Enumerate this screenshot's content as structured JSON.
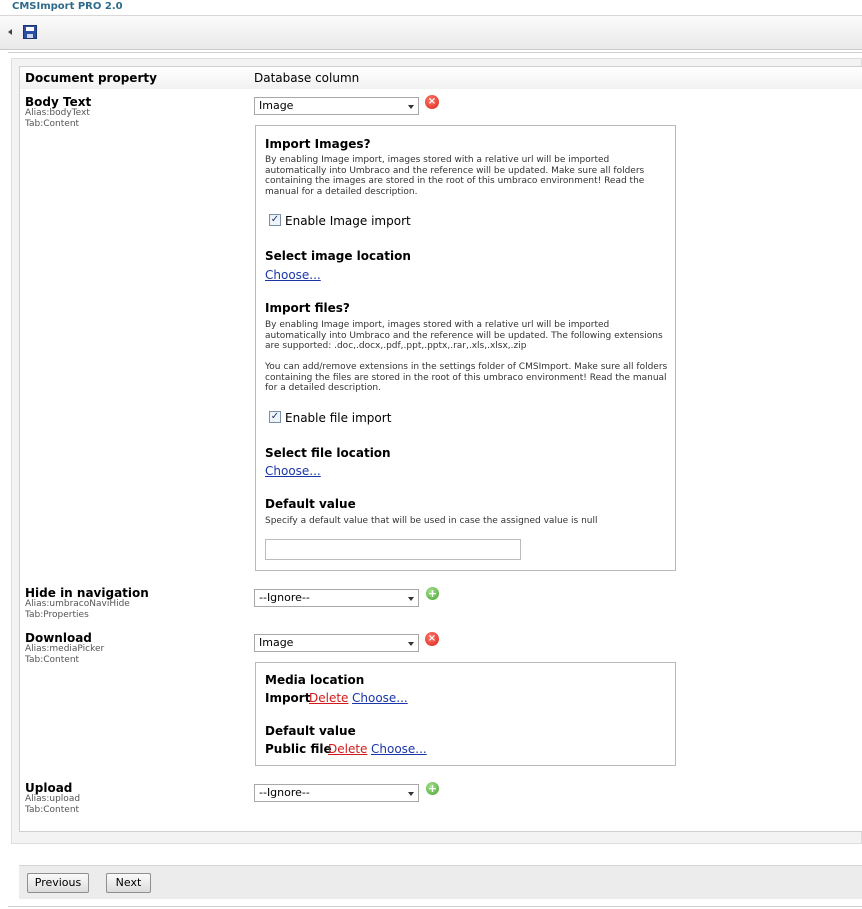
{
  "app": {
    "title": "CMSImport PRO 2.0"
  },
  "header": {
    "document_property": "Document property",
    "database_column": "Database column"
  },
  "properties": [
    {
      "name": "Body Text",
      "alias": "Alias:bodyText",
      "tab": "Tab:Content",
      "selected": "Image"
    },
    {
      "name": "Hide in navigation",
      "alias": "Alias:umbracoNaviHide",
      "tab": "Tab:Properties",
      "selected": "--Ignore--"
    },
    {
      "name": "Download",
      "alias": "Alias:mediaPicker",
      "tab": "Tab:Content",
      "selected": "Image"
    },
    {
      "name": "Upload",
      "alias": "Alias:upload",
      "tab": "Tab:Content",
      "selected": "--Ignore--"
    }
  ],
  "image_box": {
    "import_images_title": "Import Images?",
    "import_images_desc": "By enabling Image import, images stored with a relative url will be imported automatically into Umbraco and the reference will be updated. Make sure all folders containing the images are stored in the root of this umbraco environment! Read the manual for a detailed description.",
    "enable_image_import": "Enable Image import",
    "select_image_location": "Select image location",
    "choose": "Choose...",
    "import_files_title": "Import files?",
    "import_files_desc": "By enabling Image import, images stored with a relative url will be imported automatically into Umbraco and the reference will be updated. The following extensions are supported: .doc,.docx,.pdf,.ppt,.pptx,.rar,.xls,.xlsx,.zip",
    "import_files_desc2": "You can add/remove extensions in the settings folder of CMSImport. Make sure all folders containing the files are stored in the root of this umbraco environment! Read the manual for a detailed description.",
    "enable_file_import": "Enable file import",
    "select_file_location": "Select file location",
    "default_value_title": "Default value",
    "default_value_desc": "Specify a default value that will be used in case the assigned value is null",
    "default_value_input": ""
  },
  "media_box": {
    "media_location_title": "Media location",
    "import_label": "Import",
    "delete": "Delete",
    "choose": "Choose...",
    "default_value_title": "Default value",
    "public_file_label": "Public file"
  },
  "footer": {
    "previous": "Previous",
    "next": "Next"
  }
}
